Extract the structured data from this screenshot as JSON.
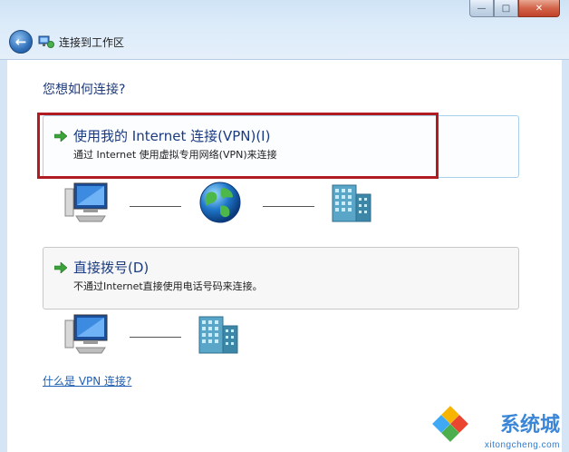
{
  "window": {
    "title": "连接到工作区",
    "buttons": {
      "minimize": "—",
      "maximize": "□",
      "close": "✕"
    }
  },
  "question": "您想如何连接?",
  "options": [
    {
      "title": "使用我的 Internet 连接(VPN)(I)",
      "description": "通过 Internet 使用虚拟专用网络(VPN)来连接",
      "highlighted": true
    },
    {
      "title": "直接拨号(D)",
      "description": "不通过Internet直接使用电话号码来连接。",
      "highlighted": false
    }
  ],
  "help_link": "什么是 VPN 连接?",
  "watermark": {
    "brand": "系统城",
    "url": "xitongcheng.com"
  },
  "colors": {
    "highlight_border": "#b01c22",
    "link": "#1f5fb2",
    "heading": "#1e3a78"
  },
  "icons": {
    "back": "back-arrow-icon",
    "option_arrow": "green-arrow-icon",
    "computer": "computer-icon",
    "globe": "internet-globe-icon",
    "server": "corporate-building-icon"
  }
}
